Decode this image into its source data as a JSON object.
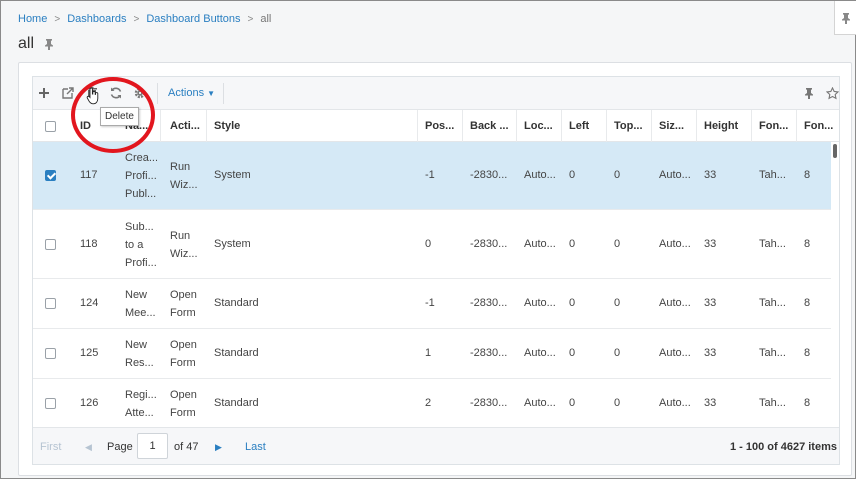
{
  "breadcrumb": [
    {
      "label": "Home"
    },
    {
      "label": "Dashboards"
    },
    {
      "label": "Dashboard Buttons"
    },
    {
      "label": "all"
    }
  ],
  "page": {
    "title": "all"
  },
  "toolbar": {
    "actions_label": "Actions",
    "tooltip": "Delete",
    "icons": [
      "plus-icon",
      "external-link-icon",
      "trash-icon",
      "refresh-icon",
      "gear-icon",
      "pin-icon",
      "star-icon"
    ]
  },
  "columns": [
    "ID",
    "Na...",
    "Acti...",
    "Style",
    "Pos...",
    "Back ...",
    "Loc...",
    "Left",
    "Top...",
    "Siz...",
    "Height",
    "Fon...",
    "Fon..."
  ],
  "rows": [
    {
      "checked": true,
      "id": "117",
      "name": "Crea... Profi... Publ...",
      "action": "Run Wiz...",
      "style": "System",
      "pos": "-1",
      "back": "-2830...",
      "loc": "Auto...",
      "left": "0",
      "top": "0",
      "size": "Auto...",
      "height": "33",
      "font": "Tah...",
      "fontsize": "8"
    },
    {
      "checked": false,
      "id": "118",
      "name": "Sub... to a Profi...",
      "action": "Run Wiz...",
      "style": "System",
      "pos": "0",
      "back": "-2830...",
      "loc": "Auto...",
      "left": "0",
      "top": "0",
      "size": "Auto...",
      "height": "33",
      "font": "Tah...",
      "fontsize": "8"
    },
    {
      "checked": false,
      "id": "124",
      "name": "New Mee...",
      "action": "Open Form",
      "style": "Standard",
      "pos": "-1",
      "back": "-2830...",
      "loc": "Auto...",
      "left": "0",
      "top": "0",
      "size": "Auto...",
      "height": "33",
      "font": "Tah...",
      "fontsize": "8"
    },
    {
      "checked": false,
      "id": "125",
      "name": "New Res...",
      "action": "Open Form",
      "style": "Standard",
      "pos": "1",
      "back": "-2830...",
      "loc": "Auto...",
      "left": "0",
      "top": "0",
      "size": "Auto...",
      "height": "33",
      "font": "Tah...",
      "fontsize": "8"
    },
    {
      "checked": false,
      "id": "126",
      "name": "Regi... Atte...",
      "action": "Open Form",
      "style": "Standard",
      "pos": "2",
      "back": "-2830...",
      "loc": "Auto...",
      "left": "0",
      "top": "0",
      "size": "Auto...",
      "height": "33",
      "font": "Tah...",
      "fontsize": "8"
    }
  ],
  "pager": {
    "first": "First",
    "page_label": "Page",
    "page_value": "1",
    "of_label": "of 47",
    "last": "Last",
    "items": "1 - 100 of 4627 items"
  },
  "colors": {
    "accent": "#2a7fc1",
    "selected_row": "#d5e9f6",
    "highlight_ring": "#e2161e"
  }
}
